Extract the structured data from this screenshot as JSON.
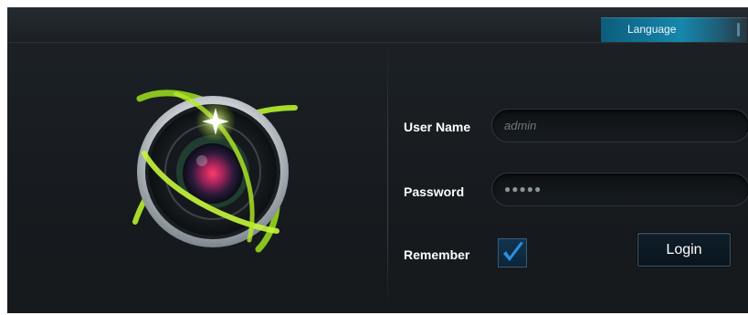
{
  "header": {
    "language_label": "Language"
  },
  "form": {
    "username_label": "User Name",
    "username_placeholder": "admin",
    "password_label": "Password",
    "password_mask": "●●●●●",
    "remember_label": "Remember",
    "remember_checked": true,
    "login_label": "Login"
  },
  "icons": {
    "logo": "camera-lens-icon",
    "check": "checkmark-icon"
  },
  "colors": {
    "accent": "#1687ad",
    "checkmark": "#2d8fe0",
    "lens_glow": "#b6f02a"
  }
}
